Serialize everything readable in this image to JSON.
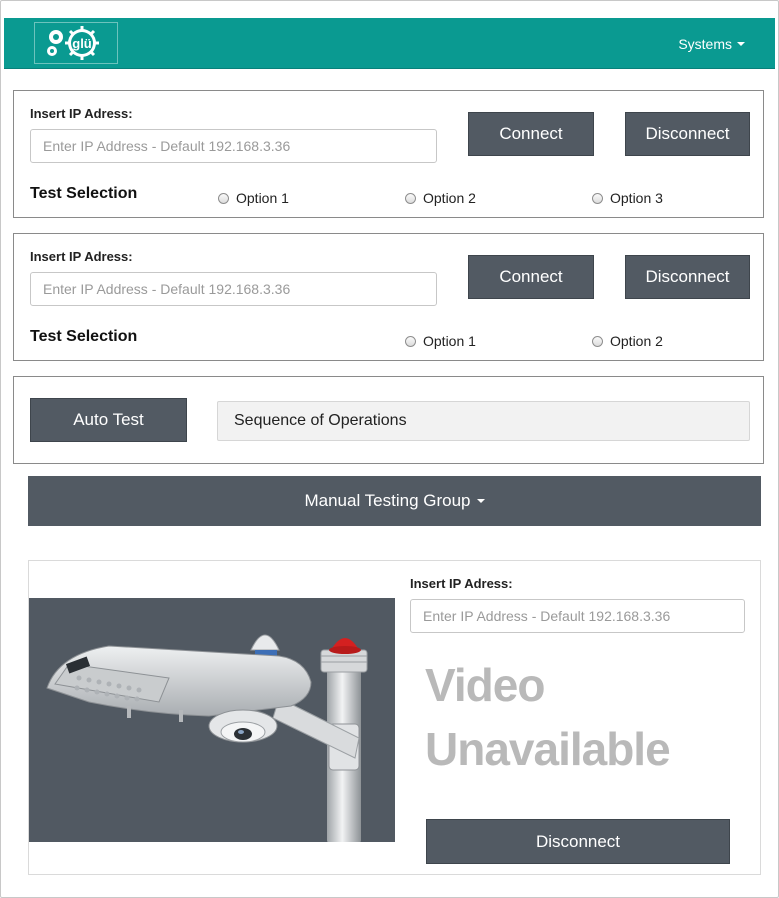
{
  "header": {
    "logo_text": "glü",
    "systems_menu": "Systems"
  },
  "panel1": {
    "ip_label": "Insert IP Adress:",
    "ip_placeholder": "Enter IP Address - Default 192.168.3.36",
    "connect": "Connect",
    "disconnect": "Disconnect",
    "test_selection": "Test Selection",
    "options": [
      "Option 1",
      "Option 2",
      "Option 3"
    ]
  },
  "panel2": {
    "ip_label": "Insert IP Adress:",
    "ip_placeholder": "Enter IP Address - Default 192.168.3.36",
    "connect": "Connect",
    "disconnect": "Disconnect",
    "test_selection": "Test Selection",
    "options": [
      "Option 1",
      "Option 2"
    ]
  },
  "auto": {
    "button": "Auto Test",
    "sequence": "Sequence of Operations"
  },
  "manual": {
    "label": "Manual Testing Group"
  },
  "camera": {
    "ip_label": "Insert IP Adress:",
    "ip_placeholder": "Enter IP Address - Default 192.168.3.36",
    "video_line1": "Video",
    "video_line2": "Unavailable",
    "disconnect": "Disconnect"
  },
  "colors": {
    "header": "#0a9a91",
    "button": "#525a63",
    "video_text": "#b9b9b9"
  }
}
